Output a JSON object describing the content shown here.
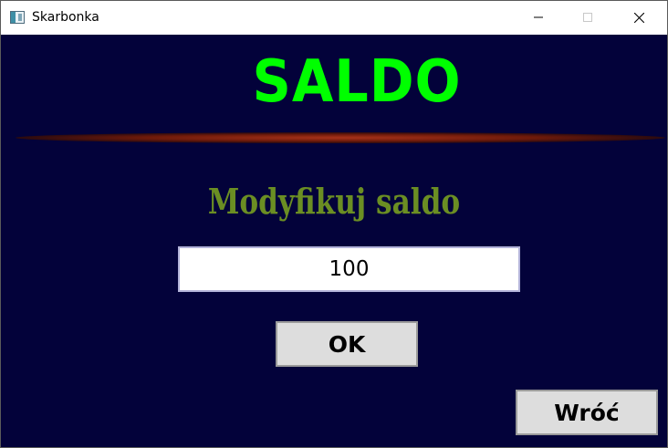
{
  "window": {
    "title": "Skarbonka",
    "app_icon": "app-window-icon",
    "controls": [
      "minimize-icon",
      "maximize-icon",
      "close-icon"
    ]
  },
  "main": {
    "heading": "SALDO",
    "subheading": "Modyfikuj saldo",
    "amount_value": "100",
    "ok_label": "OK",
    "back_label": "Wróć"
  },
  "colors": {
    "background": "#03023a",
    "heading": "#00ff00",
    "subheading": "#6b8e23",
    "divider": "#8b1e0e",
    "button_face": "#dddddd"
  }
}
